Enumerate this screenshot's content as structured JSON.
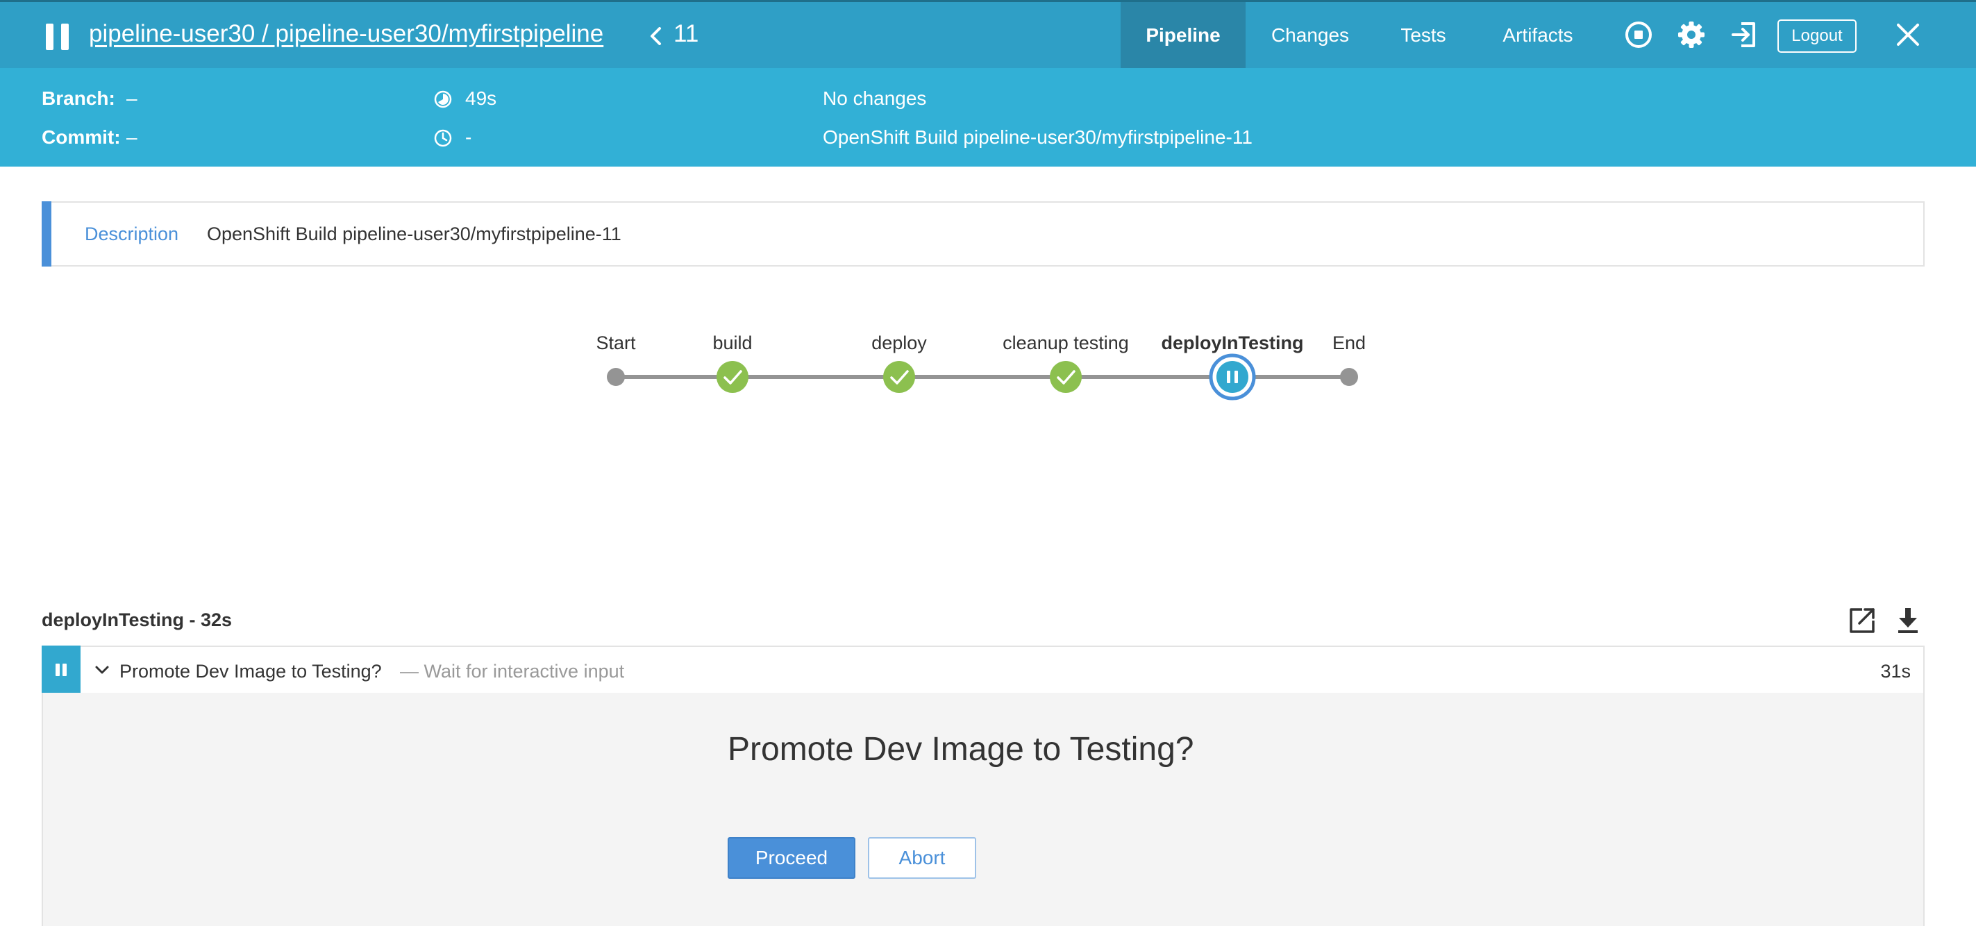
{
  "header": {
    "breadcrumb": "pipeline-user30 / pipeline-user30/myfirstpipeline",
    "run_number": "11",
    "tabs": [
      {
        "label": "Pipeline",
        "active": true
      },
      {
        "label": "Changes",
        "active": false
      },
      {
        "label": "Tests",
        "active": false
      },
      {
        "label": "Artifacts",
        "active": false
      }
    ],
    "icons": [
      "pause-icon",
      "chevron-left-icon",
      "stop-icon",
      "gear-icon",
      "exit-icon",
      "close-icon"
    ],
    "logout_label": "Logout",
    "colors": {
      "bar": "#2f9fc6",
      "active_tab": "#2a86a8"
    }
  },
  "info": {
    "branch_label": "Branch:",
    "branch_value": "–",
    "commit_label": "Commit:",
    "commit_value": "–",
    "duration": "49s",
    "started": "-",
    "changes": "No changes",
    "build_name": "OpenShift Build pipeline-user30/myfirstpipeline-11",
    "color": "#32b0d6"
  },
  "description": {
    "label": "Description",
    "text": "OpenShift Build pipeline-user30/myfirstpipeline-11"
  },
  "pipeline": {
    "stages": [
      {
        "label": "Start",
        "status": "terminal"
      },
      {
        "label": "build",
        "status": "success"
      },
      {
        "label": "deploy",
        "status": "success"
      },
      {
        "label": "cleanup testing",
        "status": "success"
      },
      {
        "label": "deployInTesting",
        "status": "paused",
        "selected": true
      },
      {
        "label": "End",
        "status": "terminal"
      }
    ],
    "colors": {
      "success": "#8cc04f",
      "paused": "#32a8cf",
      "terminal": "#949494",
      "line": "#949494"
    }
  },
  "log": {
    "title": "deployInTesting - 32s",
    "step": {
      "name": "Promote Dev Image to Testing?",
      "separator": "— Wait for interactive input",
      "duration": "31s",
      "status": "paused"
    },
    "input": {
      "question": "Promote Dev Image to Testing?",
      "proceed_label": "Proceed",
      "abort_label": "Abort"
    },
    "icons": [
      "open-external-icon",
      "download-icon"
    ]
  }
}
